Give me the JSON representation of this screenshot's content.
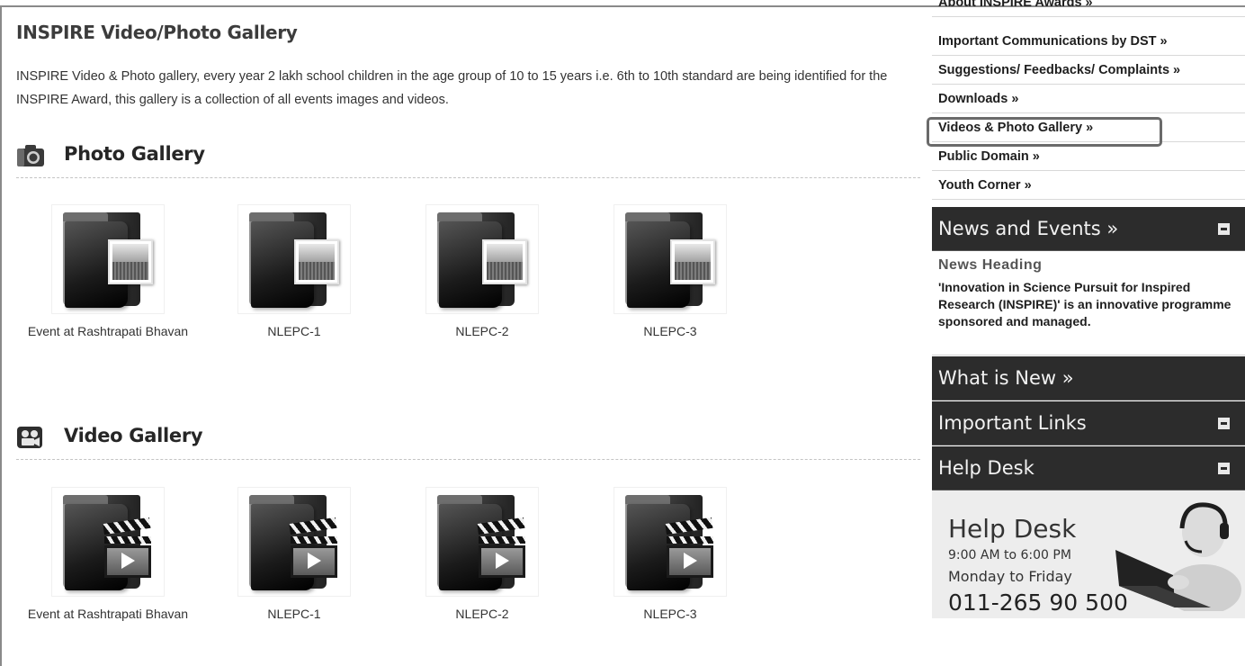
{
  "page": {
    "title": "INSPIRE Video/Photo Gallery",
    "intro": "INSPIRE Video & Photo gallery, every year 2 lakh school children in the age group of 10 to 15 years i.e. 6th to 10th standard are being identified for the INSPIRE Award, this gallery is a collection of all events images and videos."
  },
  "photo_gallery": {
    "title": "Photo Gallery",
    "icon": "camera-icon",
    "items": [
      {
        "caption": "Event at Rashtrapati Bhavan"
      },
      {
        "caption": "NLEPC-1"
      },
      {
        "caption": "NLEPC-2"
      },
      {
        "caption": "NLEPC-3"
      }
    ]
  },
  "video_gallery": {
    "title": "Video Gallery",
    "icon": "video-camera-icon",
    "items": [
      {
        "caption": "Event at Rashtrapati Bhavan"
      },
      {
        "caption": "NLEPC-1"
      },
      {
        "caption": "NLEPC-2"
      },
      {
        "caption": "NLEPC-3"
      }
    ]
  },
  "sidebar": {
    "links": [
      "About INSPIRE Awards »",
      "Important Communications by DST »",
      "Suggestions/ Feedbacks/ Complaints »",
      "Downloads »",
      "Videos & Photo Gallery »",
      "Public Domain »",
      "Youth Corner »"
    ],
    "highlighted_link": "Videos & Photo Gallery »",
    "news_events": {
      "label": "News and Events »",
      "heading": "News Heading",
      "text": "'Innovation in Science Pursuit for Inspired Research (INSPIRE)' is an innovative programme sponsored and managed."
    },
    "whats_new": "What is New »",
    "important_links": "Important Links",
    "help_desk_bar": "Help Desk",
    "help_desk": {
      "title": "Help Desk",
      "hours": "9:00 AM to 6:00 PM",
      "days": "Monday to Friday",
      "phone": "011-265 90 500"
    }
  },
  "colors": {
    "dark_bar": "#2c2c2c",
    "help_panel": "#ededed",
    "highlight_border": "#6a6a6a"
  }
}
